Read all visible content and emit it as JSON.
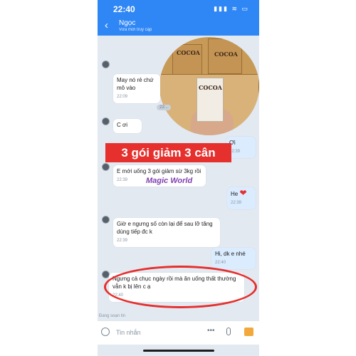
{
  "status": {
    "time": "22:40",
    "icons": "▮▮▮ ≋ ▭"
  },
  "header": {
    "back": "‹",
    "name": "Ngọc",
    "subtitle": "Vừa mới truy cập"
  },
  "messages": [
    {
      "text": "May nó rẻ chứ mô vào",
      "time": "22:09"
    },
    {
      "text": "C ơi",
      "time": ""
    },
    {
      "text": "Ơi",
      "time": "22:39"
    },
    {
      "text": "E mới uống 3 gói giảm sừ 3kg rồi",
      "time": "22:39"
    },
    {
      "text": "He",
      "time": "22:39",
      "emoji": "❤"
    },
    {
      "text": "Giờ e ngưng số còn lại để sau lỡ tăng dùng tiếp đc k",
      "time": "22:39"
    },
    {
      "text": "Hi, dk e nhé",
      "time": "22:40"
    },
    {
      "text": "Ngưng cả chục ngày rồi mà ăn uống thất thường vẫn k bị lên c ạ",
      "time": "22:40"
    }
  ],
  "date_pill": "22:..",
  "photo": {
    "cocoa_label": "COCOA"
  },
  "promo": "3 gói giảm 3 cân",
  "watermark": "Magic World",
  "typing": "Đang soạn tin",
  "input": {
    "placeholder": "Tin nhắn",
    "more": "•••"
  }
}
